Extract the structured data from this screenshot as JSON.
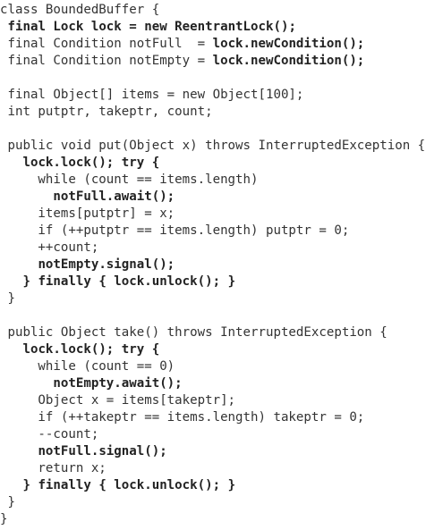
{
  "code": {
    "lines": [
      [
        {
          "t": "class BoundedBuffer {"
        }
      ],
      [
        {
          "t": " "
        },
        {
          "t": "final Lock lock = new ReentrantLock();",
          "b": true
        }
      ],
      [
        {
          "t": " final Condition notFull  = "
        },
        {
          "t": "lock.newCondition();",
          "b": true
        }
      ],
      [
        {
          "t": " final Condition notEmpty = "
        },
        {
          "t": "lock.newCondition();",
          "b": true
        }
      ],
      [
        {
          "t": ""
        }
      ],
      [
        {
          "t": " final Object[] items = new Object[100];"
        }
      ],
      [
        {
          "t": " int putptr, takeptr, count;"
        }
      ],
      [
        {
          "t": ""
        }
      ],
      [
        {
          "t": " public void put(Object x) throws InterruptedException {"
        }
      ],
      [
        {
          "t": "   "
        },
        {
          "t": "lock.lock(); try {",
          "b": true
        }
      ],
      [
        {
          "t": "     while (count == items.length)"
        }
      ],
      [
        {
          "t": "       "
        },
        {
          "t": "notFull.await();",
          "b": true
        }
      ],
      [
        {
          "t": "     items[putptr] = x;"
        }
      ],
      [
        {
          "t": "     if (++putptr == items.length) putptr = 0;"
        }
      ],
      [
        {
          "t": "     ++count;"
        }
      ],
      [
        {
          "t": "     "
        },
        {
          "t": "notEmpty.signal();",
          "b": true
        }
      ],
      [
        {
          "t": "   "
        },
        {
          "t": "} finally { lock.unlock(); }",
          "b": true
        }
      ],
      [
        {
          "t": " }"
        }
      ],
      [
        {
          "t": ""
        }
      ],
      [
        {
          "t": " public Object take() throws InterruptedException {"
        }
      ],
      [
        {
          "t": "   "
        },
        {
          "t": "lock.lock(); try {",
          "b": true
        }
      ],
      [
        {
          "t": "     while (count == 0)"
        }
      ],
      [
        {
          "t": "       "
        },
        {
          "t": "notEmpty.await();",
          "b": true
        }
      ],
      [
        {
          "t": "     Object x = items[takeptr];"
        }
      ],
      [
        {
          "t": "     if (++takeptr == items.length) takeptr = 0;"
        }
      ],
      [
        {
          "t": "     --count;"
        }
      ],
      [
        {
          "t": "     "
        },
        {
          "t": "notFull.signal();",
          "b": true
        }
      ],
      [
        {
          "t": "     return x;"
        }
      ],
      [
        {
          "t": "   "
        },
        {
          "t": "} finally { lock.unlock(); }",
          "b": true
        }
      ],
      [
        {
          "t": " }"
        }
      ],
      [
        {
          "t": "}"
        }
      ]
    ]
  }
}
